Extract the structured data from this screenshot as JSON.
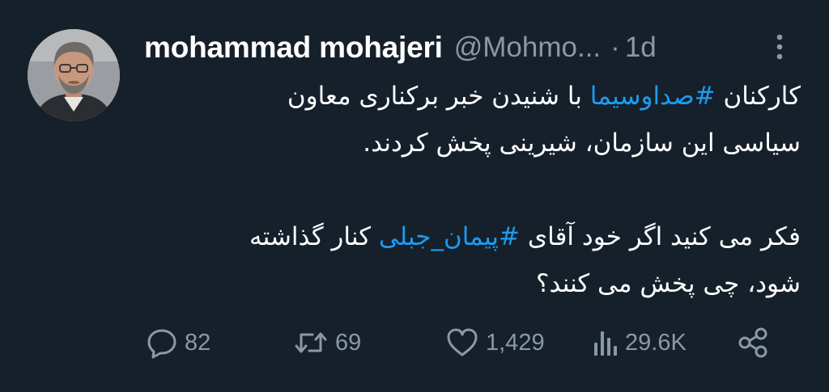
{
  "tweet": {
    "author": {
      "display_name": "mohammad mohajeri",
      "handle": "@Mohmo...",
      "separator": "·",
      "time": "1d"
    },
    "body": {
      "line1_prefix": "کارکنان ",
      "hashtag1": "#صداوسیما",
      "line1_suffix": " با شنیدن خبر برکناری معاون",
      "line2": "سیاسی این سازمان، شیرینی پخش کردند.",
      "line3_prefix": "فکر می کنید اگر خود آقای ",
      "hashtag2": "#پیمان_جبلی",
      "line3_suffix": " کنار گذاشته",
      "line4": "شود، چی پخش می کنند؟"
    },
    "actions": {
      "replies": "82",
      "retweets": "69",
      "likes": "1,429",
      "views": "29.6K"
    },
    "icons": {
      "reply": "reply-bubble-icon",
      "retweet": "retweet-icon",
      "like": "heart-icon",
      "views": "bar-chart-icon",
      "share": "share-icon",
      "more": "more-vertical-icon"
    },
    "colors": {
      "background": "#15202b",
      "text": "#ffffff",
      "secondary": "#8b98a5",
      "link": "#1d9bf0"
    }
  }
}
